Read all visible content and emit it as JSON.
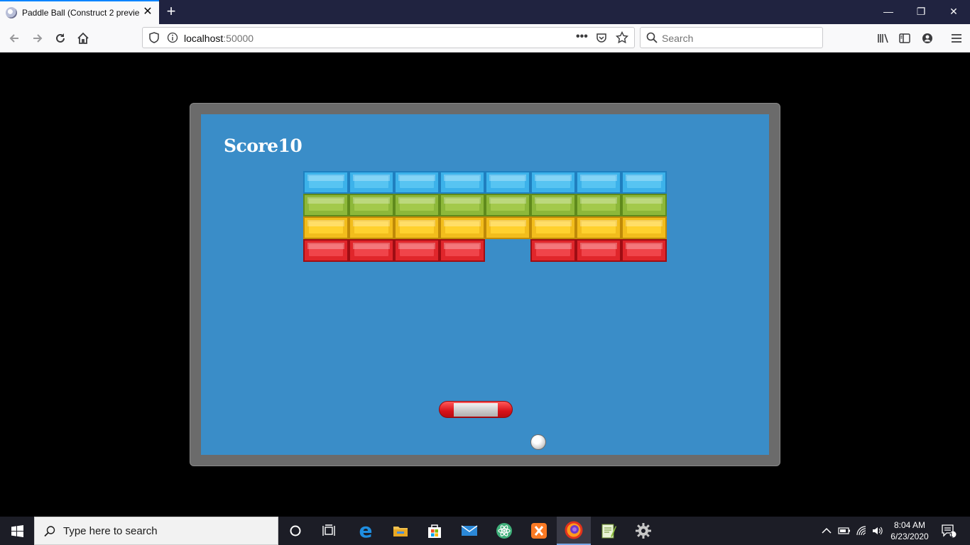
{
  "browser": {
    "tab_title": "Paddle Ball (Construct 2 previe",
    "url_host": "localhost",
    "url_port": ":50000",
    "search_placeholder": "Search"
  },
  "game": {
    "score_label": "Score",
    "score_value": "10",
    "brick_rows": [
      {
        "color": "blue",
        "present": [
          true,
          true,
          true,
          true,
          true,
          true,
          true,
          true
        ]
      },
      {
        "color": "green",
        "present": [
          true,
          true,
          true,
          true,
          true,
          true,
          true,
          true
        ]
      },
      {
        "color": "yellow",
        "present": [
          true,
          true,
          true,
          true,
          true,
          true,
          true,
          true
        ]
      },
      {
        "color": "red",
        "present": [
          true,
          true,
          true,
          true,
          false,
          true,
          true,
          true
        ]
      }
    ]
  },
  "taskbar": {
    "search_placeholder": "Type here to search",
    "time": "8:04 AM",
    "date": "6/23/2020",
    "notification_count": "1"
  },
  "colors": {
    "playfield": "#3a8dc8",
    "frame": "#6b6b6b",
    "accent": "#0a84ff"
  }
}
